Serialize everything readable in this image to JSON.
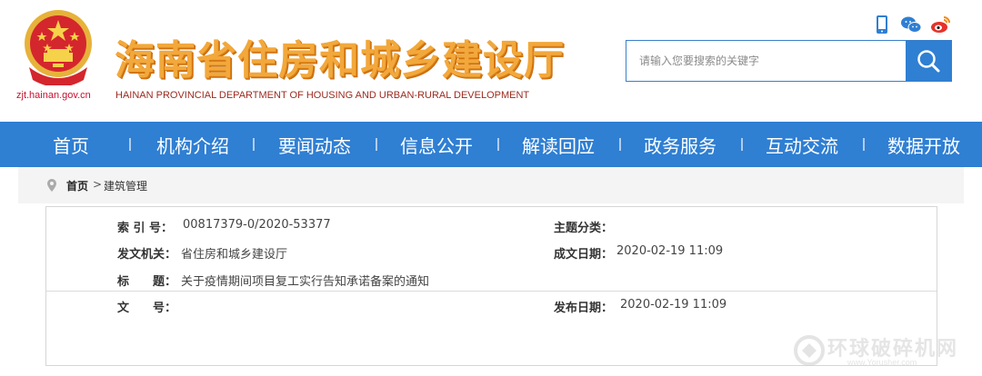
{
  "header": {
    "domain": "zjt.hainan.gov.cn",
    "title": "海南省住房和城乡建设厅",
    "title_en": "HAINAN PROVINCIAL DEPARTMENT OF HOUSING AND URBAN-RURAL DEVELOPMENT",
    "search_placeholder": "请输入您要搜索的关键字",
    "icons": [
      "mobile-icon",
      "wechat-icon",
      "weibo-icon",
      "search-icon"
    ]
  },
  "nav": {
    "items": [
      "首页",
      "机构介绍",
      "要闻动态",
      "信息公开",
      "解读回应",
      "政务服务",
      "互动交流",
      "数据开放"
    ]
  },
  "breadcrumb": {
    "home": "首页",
    "separator": ">",
    "current": "建筑管理"
  },
  "info": {
    "index_label": "索 引 号：",
    "index_value": "00817379-0/2020-53377",
    "topic_label": "主题分类：",
    "topic_value": "",
    "issuer_label": "发文机关：",
    "issuer_value": "省住房和城乡建设厅",
    "created_label": "成文日期：",
    "created_value": "2020-02-19 11:09",
    "title_label": "标　　题：",
    "title_value": "关于疫情期间项目复工实行告知承诺备案的通知",
    "docno_label": "文　　号：",
    "docno_value": "",
    "published_label": "发布日期：",
    "published_value": "2020-02-19 11:09"
  },
  "watermark": {
    "text": "环球破碎机网",
    "url": "www.Yorusher.com"
  },
  "colors": {
    "primary_blue": "#2f7fd3",
    "title_orange": "#f2a83b",
    "emblem_red": "#c8102e"
  }
}
